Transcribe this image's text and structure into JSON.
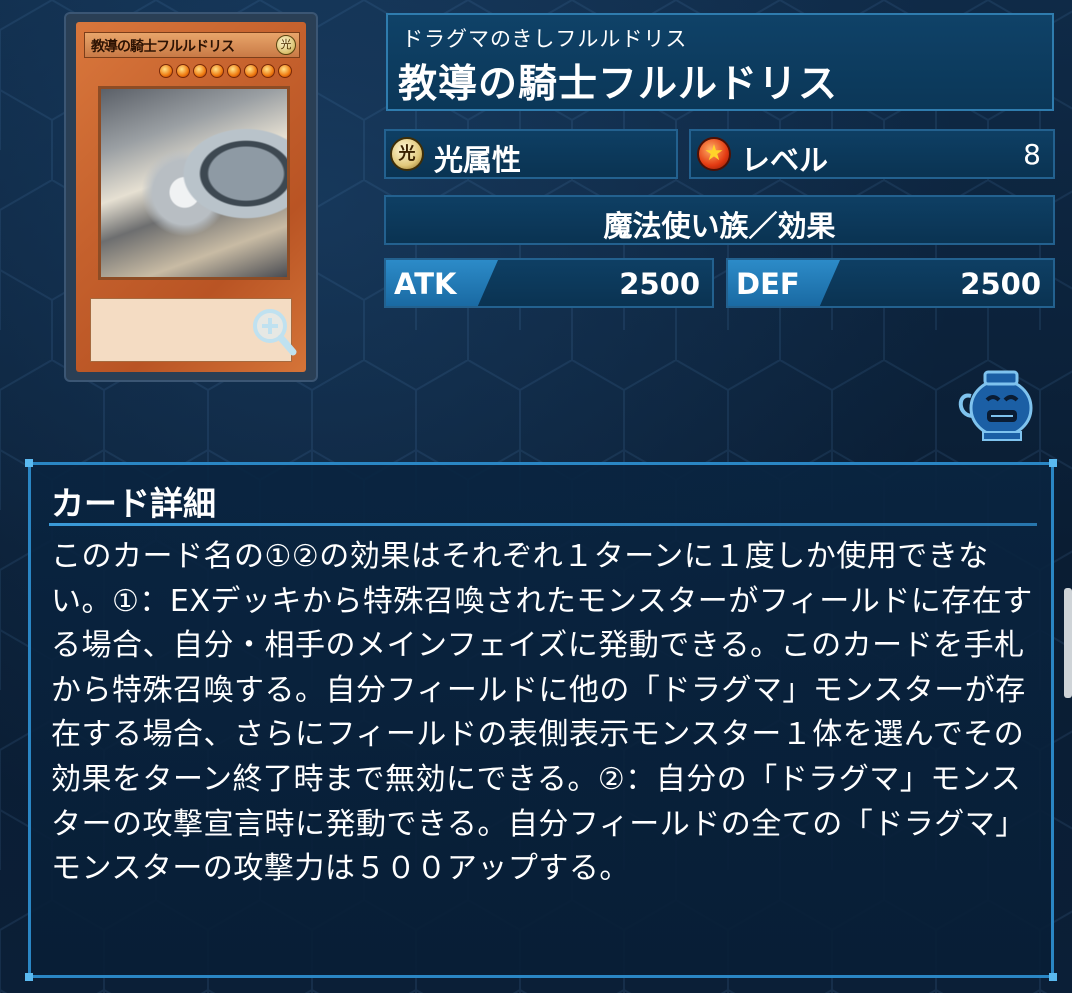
{
  "card": {
    "ruby": "ドラグマのきしフルルドリス",
    "name": "教導の騎士フルルドリス",
    "attribute": "光属性",
    "attribute_glyph": "光",
    "level_label": "レベル",
    "level_value": "8",
    "type": "魔法使い族／効果",
    "atk_label": "ATK",
    "atk_value": "2500",
    "def_label": "DEF",
    "def_value": "2500",
    "thumbnail": {
      "name": "教導の騎士フルルドリス",
      "attribute_glyph": "光",
      "stars": 8
    }
  },
  "icons": {
    "zoom": "magnifier-plus-icon",
    "attribute": "light-attribute-icon",
    "level": "level-star-icon",
    "pot": "pot-of-greed-icon"
  },
  "detail": {
    "title": "カード詳細",
    "text": "このカード名の①②の効果はそれぞれ１ターンに１度しか使用できない。①：EXデッキから特殊召喚されたモンスターがフィールドに存在する場合、自分・相手のメインフェイズに発動できる。このカードを手札から特殊召喚する。自分フィールドに他の「ドラグマ」モンスターが存在する場合、さらにフィールドの表側表示モンスター１体を選んでその効果をターン終了時まで無効にできる。②：自分の「ドラグマ」モンスターの攻撃宣言時に発動できる。自分フィールドの全ての「ドラグマ」モンスターの攻撃力は５００アップする。"
  },
  "colors": {
    "background": "#0c2038",
    "panel_border": "#2a86c4",
    "stat_tag": "#2c8bc8",
    "card_frame": "#c5612d"
  }
}
